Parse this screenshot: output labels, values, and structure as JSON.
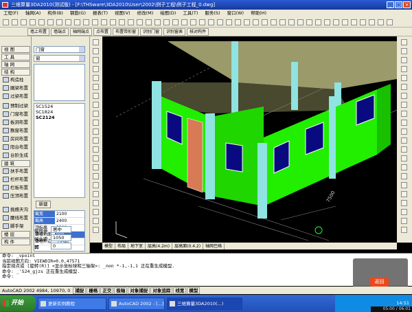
{
  "window": {
    "title": "三维算量3DA2010(测试版) - [F:\\THSware\\3DA2010\\User\\2002\\例子工程\\例子工程_0.dwg]"
  },
  "menu": [
    "工程(F)",
    "轴网(A)",
    "构件(B)",
    "钢筋(G)",
    "报表(T)",
    "视图(V)",
    "修改(M)",
    "绘图(D)",
    "工具(T)",
    "服务(S)",
    "窗口(W)",
    "帮助(H)"
  ],
  "toolbar_buttons": [
    "墙上布置",
    "墙端点",
    "轴网端点",
    "点布置",
    "布置带形窗",
    "识别门窗",
    "识别窗表",
    "核对构件"
  ],
  "left_panel": {
    "categories": [
      "视 图",
      "工 具",
      "轴 网",
      "结 构",
      "建 筑",
      "楼 层",
      "构 件"
    ],
    "building_items": [
      "构造柱",
      "圈梁布置",
      "过梁布置",
      "预制过梁",
      "门窗布置",
      "板洞布置",
      "飘窗布置",
      "房间布置",
      "阳台布置",
      "台阶生成"
    ],
    "struct_items": [
      "扶手布置",
      "栏杆布置",
      "栏板布置",
      "压顶布置",
      "挑檐天沟",
      "腰线布置",
      "脚手架"
    ]
  },
  "prop_panel": {
    "type_select": "门窗",
    "subtype_select": "窗",
    "list": [
      "SC1524",
      "SC1824",
      "SC2124"
    ],
    "new_button": "新建",
    "props": [
      {
        "k": "截宽",
        "v": "2100"
      },
      {
        "k": "截高",
        "v": "2400"
      },
      {
        "k": "顶标高(mm",
        "v": "3300"
      },
      {
        "k": "离楼地面(mm",
        "v": "900"
      },
      {
        "k": "立樘外边距",
        "v": "平内边"
      }
    ],
    "bottom_fields": [
      {
        "k": "偏移参",
        "v": "居中"
      },
      {
        "k": "端头距",
        "v": "1050"
      },
      {
        "k": "转",
        "v": "0"
      }
    ]
  },
  "view_tabs": [
    "模型",
    "布局",
    "地下室",
    "层高(4.2m)",
    "层高面(0.4.2)",
    "轴网巴格"
  ],
  "viewport": {
    "dimension_label": "7500"
  },
  "command_lines": [
    "命令: _vpoint",
    "当前视图方向: VIEWDIR=0.0,47571",
    "指定视点或 [旋转(R)] <显示坐标球和三轴架>: _non *-1,-1,1 正在重生成模型.",
    "命令: _'S24_gjzs 正在重生成模型.",
    "命令:"
  ],
  "status": {
    "coords": "AutoCAD 2002  4984, 10970, 0",
    "modes": [
      "捕捉",
      "栅格",
      "正交",
      "极轴",
      "对象捕捉",
      "对象追踪",
      "线宽",
      "模型"
    ]
  },
  "taskbar": {
    "start": "开始",
    "tasks": [
      "更新实例教程",
      "AutoCAD 2002 - [...]",
      "三维算量3DA2010(...)"
    ],
    "clock": "14:51"
  },
  "player": {
    "back": "返回",
    "time": "05:00 / 06:01"
  },
  "colors": {
    "wall": "#22ee00",
    "column": "#8fe3e0",
    "door": "#d87a55",
    "title": "#2a5bd6"
  }
}
